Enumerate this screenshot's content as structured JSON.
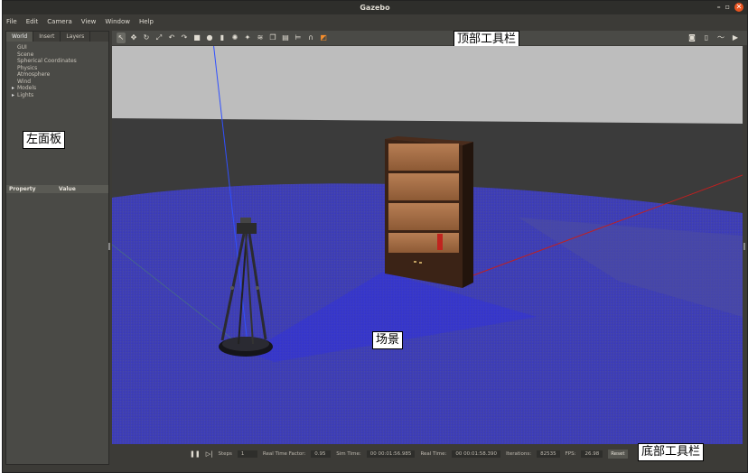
{
  "window": {
    "title": "Gazebo",
    "controls": [
      "–",
      "▫",
      "✕"
    ]
  },
  "menubar": {
    "items": [
      "File",
      "Edit",
      "Camera",
      "View",
      "Window",
      "Help"
    ]
  },
  "left_panel": {
    "tabs": [
      "World",
      "Insert",
      "Layers"
    ],
    "tree": [
      {
        "label": "GUI",
        "expandable": false
      },
      {
        "label": "Scene",
        "expandable": false
      },
      {
        "label": "Spherical Coordinates",
        "expandable": false
      },
      {
        "label": "Physics",
        "expandable": false
      },
      {
        "label": "Atmosphere",
        "expandable": false
      },
      {
        "label": "Wind",
        "expandable": false
      },
      {
        "label": "Models",
        "expandable": true
      },
      {
        "label": "Lights",
        "expandable": true
      }
    ],
    "property_header": {
      "property": "Property",
      "value": "Value"
    }
  },
  "annotations": {
    "left_panel": "左面板",
    "top_toolbar": "顶部工具栏",
    "scene": "场景",
    "bottom_toolbar": "底部工具栏"
  },
  "top_toolbar": {
    "tools": [
      "select-icon",
      "translate-icon",
      "rotate-icon",
      "scale-icon",
      "undo-icon",
      "redo-icon",
      "box-icon",
      "sphere-icon",
      "cylinder-icon",
      "point-light-icon",
      "spot-light-icon",
      "directional-light-icon",
      "copy-icon",
      "paste-icon",
      "align-icon",
      "snap-icon",
      "change-view-icon"
    ],
    "right_tools": [
      "screenshot-icon",
      "log-icon",
      "plot-icon",
      "record-icon"
    ]
  },
  "bottom_toolbar": {
    "pause_icon": "pause-icon",
    "step_icon": "step-icon",
    "steps_label": "Steps",
    "steps_value": "1",
    "rtf_label": "Real Time Factor:",
    "rtf_value": "0.95",
    "sim_time_label": "Sim Time:",
    "sim_time_value": "00 00:01:56.985",
    "real_time_label": "Real Time:",
    "real_time_value": "00 00:01:58.390",
    "iterations_label": "Iterations:",
    "iterations_value": "82535",
    "fps_label": "FPS:",
    "fps_value": "26.98",
    "reset_label": "Reset"
  },
  "colors": {
    "window_bg": "#3c3b37",
    "panel_bg": "#4a4a46",
    "ground": "#3b3ba8",
    "accent_orange": "#e95420",
    "wall_dark": "#3a3a3a",
    "sky": "#bdbdbd"
  }
}
